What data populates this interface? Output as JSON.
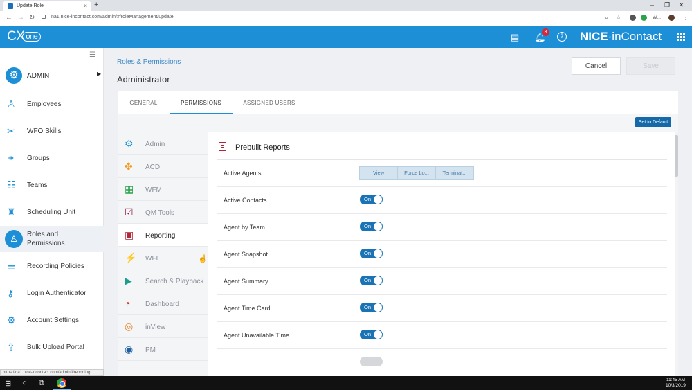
{
  "browser": {
    "tab_title": "Update Role",
    "tab_close": "×",
    "new_tab": "+",
    "url": "na1.nice-incontact.com/admin/#/roleManagement/update",
    "window_controls": [
      "–",
      "❐",
      "✕"
    ],
    "profile_label": "W..."
  },
  "header": {
    "logo_main": "CX",
    "logo_sub": "one",
    "notification_count": "3",
    "brand_main": "NICE",
    "brand_sep": "·",
    "brand_sub": "inContact",
    "icons": [
      "monitor-icon",
      "bell-icon",
      "help-icon",
      "apps-grid-icon"
    ]
  },
  "sidebar": {
    "user": "ADMIN",
    "items": [
      {
        "label": "Employees",
        "icon": "person-icon"
      },
      {
        "label": "WFO Skills",
        "icon": "tools-icon"
      },
      {
        "label": "Groups",
        "icon": "groups-icon"
      },
      {
        "label": "Teams",
        "icon": "teams-icon"
      },
      {
        "label": "Scheduling Unit",
        "icon": "scheduling-icon"
      },
      {
        "label": "Roles and Permissions",
        "label_line1": "Roles and",
        "label_line2": "Permissions",
        "icon": "role-icon",
        "active": true
      },
      {
        "label": "Recording Policies",
        "icon": "sliders-icon"
      },
      {
        "label": "Login Authenticator",
        "icon": "key-icon"
      },
      {
        "label": "Account Settings",
        "icon": "gear-icon"
      },
      {
        "label": "Bulk Upload Portal",
        "icon": "upload-icon"
      }
    ]
  },
  "page": {
    "breadcrumb": "Roles & Permissions",
    "title": "Administrator",
    "cancel_label": "Cancel",
    "save_label": "Save",
    "tabs": [
      {
        "label": "GENERAL"
      },
      {
        "label": "PERMISSIONS",
        "active": true
      },
      {
        "label": "ASSIGNED USERS"
      }
    ],
    "set_default_label": "Set to Default"
  },
  "categories": [
    {
      "label": "Admin",
      "icon": "admin-gear-icon"
    },
    {
      "label": "ACD",
      "icon": "acd-icon"
    },
    {
      "label": "WFM",
      "icon": "calendar-icon"
    },
    {
      "label": "QM Tools",
      "icon": "checklist-icon"
    },
    {
      "label": "Reporting",
      "icon": "reporting-icon",
      "active": true
    },
    {
      "label": "WFI",
      "icon": "wfi-icon"
    },
    {
      "label": "Search & Playback",
      "icon": "playback-icon"
    },
    {
      "label": "Dashboard",
      "icon": "dashboard-icon"
    },
    {
      "label": "inView",
      "icon": "target-icon"
    },
    {
      "label": "PM",
      "icon": "pm-icon"
    }
  ],
  "panel": {
    "title": "Prebuilt Reports",
    "rows": [
      {
        "name": "Active Agents",
        "type": "segmented",
        "options": [
          "View",
          "Force Lo...",
          "Terminat..."
        ]
      },
      {
        "name": "Active Contacts",
        "type": "toggle",
        "state": "On"
      },
      {
        "name": "Agent by Team",
        "type": "toggle",
        "state": "On"
      },
      {
        "name": "Agent Snapshot",
        "type": "toggle",
        "state": "On"
      },
      {
        "name": "Agent Summary",
        "type": "toggle",
        "state": "On"
      },
      {
        "name": "Agent Time Card",
        "type": "toggle",
        "state": "On"
      },
      {
        "name": "Agent Unavailable Time",
        "type": "toggle",
        "state": "On"
      }
    ]
  },
  "statusbar": {
    "url": "https://na1.nice-incontact.com/admin/#reporting"
  },
  "taskbar": {
    "time": "11:45 AM",
    "date": "10/3/2019"
  }
}
